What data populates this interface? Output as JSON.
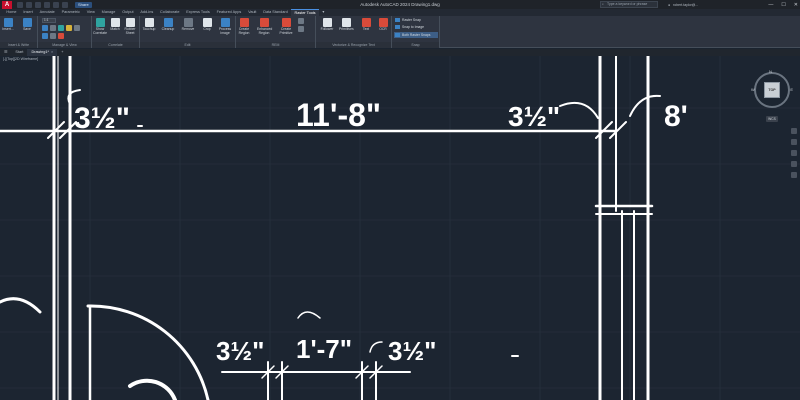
{
  "app": {
    "logo_letter": "A",
    "title": "Autodesk AutoCAD 2024    Drawing1.dwg",
    "share_label": "Share",
    "search_placeholder": "Type a keyword or phrase",
    "user_label": "robert.taylor@...",
    "window_controls": [
      "—",
      "☐",
      "✕"
    ]
  },
  "ribbon_tabs": [
    {
      "label": "Home",
      "active": false
    },
    {
      "label": "Insert",
      "active": false
    },
    {
      "label": "Annotate",
      "active": false
    },
    {
      "label": "Parametric",
      "active": false
    },
    {
      "label": "View",
      "active": false
    },
    {
      "label": "Manage",
      "active": false
    },
    {
      "label": "Output",
      "active": false
    },
    {
      "label": "Add-ins",
      "active": false
    },
    {
      "label": "Collaborate",
      "active": false
    },
    {
      "label": "Express Tools",
      "active": false
    },
    {
      "label": "Featured Apps",
      "active": false
    },
    {
      "label": "Vault",
      "active": false
    },
    {
      "label": "Data Standard",
      "active": false
    },
    {
      "label": "Raster Tools",
      "active": true
    }
  ],
  "ribbon": {
    "panels": [
      {
        "title": "Insert & Write",
        "buttons": [
          "Insert...",
          "Save"
        ]
      },
      {
        "title": "Manage & View",
        "dropdown": "1:1",
        "buttons": []
      },
      {
        "title": "Correlate",
        "buttons": [
          "Show Correlate",
          "Match",
          "Rubber Sheet"
        ]
      },
      {
        "title": "Edit",
        "buttons": [
          "Touchup",
          "Cleanup",
          "Remove",
          "Crop",
          "Process Image"
        ]
      },
      {
        "title": "REM",
        "buttons": [
          "Create Region",
          "Enhanced Region",
          "Create Primitive"
        ]
      },
      {
        "title": "Vectorize & Recognize Text",
        "buttons": [
          "Follower",
          "Primitives",
          "Text",
          "OCR"
        ]
      },
      {
        "title": "Snap",
        "items": [
          "Raster Snap",
          "Snap to Image",
          "Both Raster Snaps"
        ]
      }
    ]
  },
  "doc_tabs": [
    {
      "label": "Start",
      "active": false
    },
    {
      "label": "Drawing1*",
      "active": true,
      "close": "×"
    },
    {
      "label": "+",
      "active": false
    }
  ],
  "viewport": {
    "label": "[-][Top][2D Wireframe]",
    "dimensions": {
      "top_left": "3½\"",
      "top_center": "11'-8\"",
      "top_right_1": "3½\"",
      "top_right_2": "8'",
      "bottom_1": "3½\"",
      "bottom_2": "1'-7\"",
      "bottom_3": "3½\""
    }
  },
  "viewcube": {
    "face": "TOP",
    "north": "N",
    "west": "W",
    "east": "E",
    "wcs": "WCS"
  },
  "colors": {
    "background": "#1c2531",
    "grid": "#2a3442",
    "linework": "#ffffff",
    "accent": "#4a90e2"
  }
}
